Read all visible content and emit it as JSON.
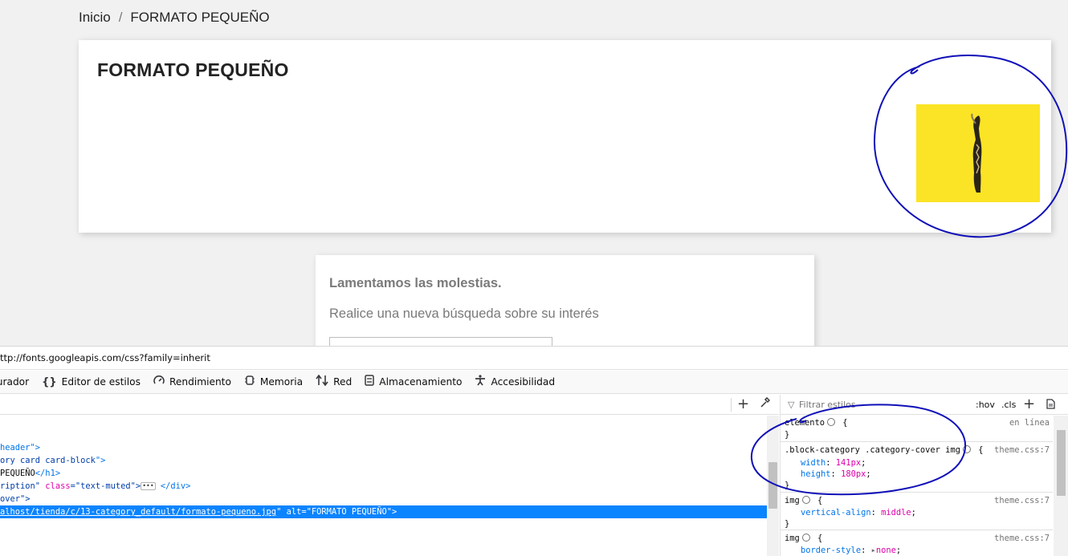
{
  "breadcrumb": {
    "home": "Inicio",
    "separator": "/",
    "current": "FORMATO PEQUEÑO"
  },
  "category": {
    "title": "FORMATO PEQUEÑO",
    "cover_bg": "#fbe425"
  },
  "notfound": {
    "heading": "Lamentamos las molestias.",
    "message": "Realice una nueva búsqueda sobre su interés"
  },
  "devtools": {
    "url": "ttp://fonts.googleapis.com/css?family=inherit",
    "tabs": [
      {
        "icon": "debugger-icon",
        "label": "purador"
      },
      {
        "icon": "braces-icon",
        "label": "Editor de estilos"
      },
      {
        "icon": "gauge-icon",
        "label": "Rendimiento"
      },
      {
        "icon": "chip-icon",
        "label": "Memoria"
      },
      {
        "icon": "arrows-icon",
        "label": "Red"
      },
      {
        "icon": "storage-icon",
        "label": "Almacenamiento"
      },
      {
        "icon": "accessibility-icon",
        "label": "Accesibilidad"
      }
    ],
    "markup": {
      "l1": "header\">",
      "l2a": "ory card card-block",
      "l2b": "\">",
      "l3a": " PEQUEÑO",
      "l3b": "</h1>",
      "l4a": "ription\"",
      "l4b": " class",
      "l4c": "=\"",
      "l4d": "text-muted",
      "l4e": "\">",
      "l4f": "</div>",
      "l5": "over\">",
      "l6a": "alhost/tienda/c/13-category_default/formato-pequeno.jpg",
      "l6b": "\" alt=\"FORMATO PEQUEÑO\">"
    },
    "rules_toolbar": {
      "filter_placeholder": "Filtrar estilos",
      "hov": ":hov",
      "cls": ".cls"
    },
    "rules": {
      "r1_selector": "elemento",
      "r1_source": "en línea",
      "r2_selector": ".block-category .category-cover img",
      "r2_source": "theme.css:7",
      "r2_width_prop": "width",
      "r2_width_val": "141px",
      "r2_height_prop": "height",
      "r2_height_val": "180px",
      "r3_selector": "img",
      "r3_source": "theme.css:7",
      "r3_prop": "vertical-align",
      "r3_val": "middle",
      "r4_selector": "img",
      "r4_source": "theme.css:7",
      "r4_prop": "border-style",
      "r4_val": "none"
    }
  },
  "colors": {
    "annotation": "#1010b8",
    "selection": "#0a84ff"
  }
}
